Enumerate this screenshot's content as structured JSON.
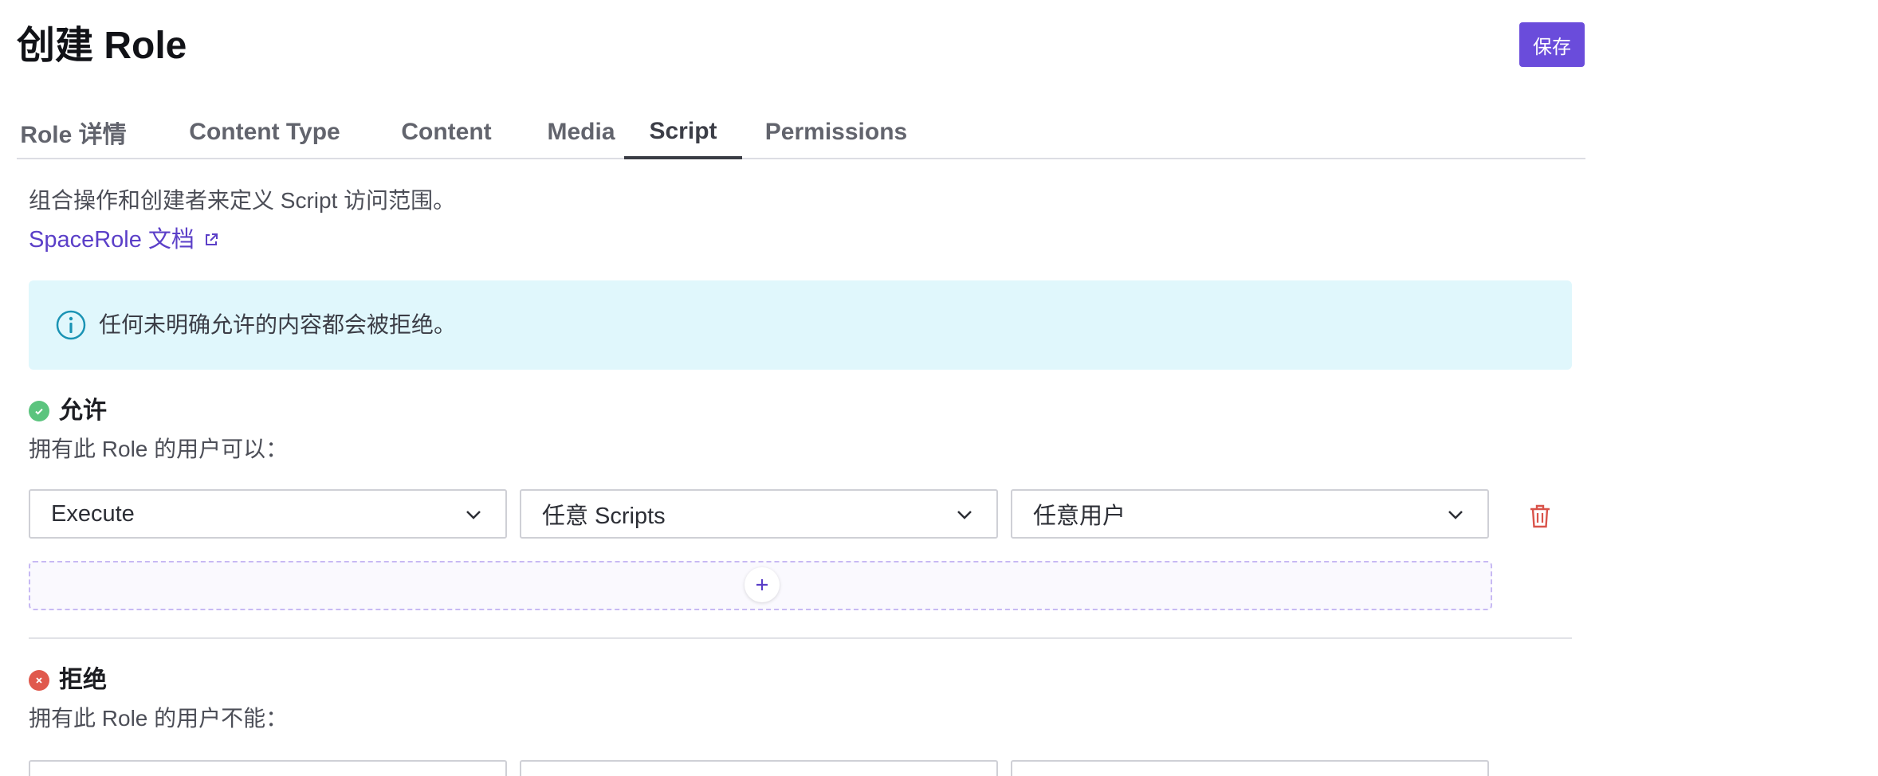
{
  "header": {
    "title": "创建 Role",
    "save_label": "保存"
  },
  "tabs": [
    {
      "label": "Role 详情",
      "active": false
    },
    {
      "label": "Content Type",
      "active": false
    },
    {
      "label": "Content",
      "active": false
    },
    {
      "label": "Media",
      "active": false
    },
    {
      "label": "Script",
      "active": true
    },
    {
      "label": "Permissions",
      "active": false
    }
  ],
  "intro": {
    "description": "组合操作和创建者来定义 Script 访问范围。",
    "docs_link": "SpaceRole 文档",
    "docs_icon": "external-link-icon"
  },
  "info": {
    "icon": "info-icon",
    "text": "任何未明确允许的内容都会被拒绝。"
  },
  "allow": {
    "title": "允许",
    "subtitle": "拥有此 Role 的用户可以：",
    "status_color": "#5bc47e",
    "rule": {
      "action": "Execute",
      "scope": "任意 Scripts",
      "creator": "任意用户"
    }
  },
  "deny": {
    "title": "拒绝",
    "subtitle": "拥有此 Role 的用户不能：",
    "status_color": "#e0594d"
  },
  "colors": {
    "accent": "#6a4cdb",
    "link": "#5b3fc8",
    "info_bg": "#e0f7fc",
    "info_icon": "#1a93b4",
    "delete": "#d9534a"
  }
}
